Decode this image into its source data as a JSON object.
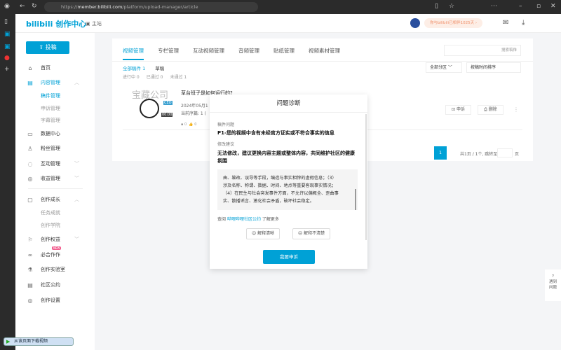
{
  "browser": {
    "url_prefix": "https://",
    "url_host": "member.bilibili.com",
    "url_path": "/platform/upload-manager/article"
  },
  "header": {
    "logo": "bilibili 创作中心",
    "home_link": "主站",
    "promo": "你与bilibili已相伴1025天 ›"
  },
  "sidebar": {
    "upload_label": "投稿",
    "items": [
      {
        "label": "首页",
        "icon": "home-icon"
      },
      {
        "label": "内容管理",
        "icon": "document-icon",
        "active": true
      },
      {
        "label": "稿件管理",
        "sub": true,
        "active": true
      },
      {
        "label": "申诉管理",
        "sub": true
      },
      {
        "label": "字幕管理",
        "sub": true
      },
      {
        "label": "数据中心",
        "icon": "chart-icon"
      },
      {
        "label": "粉丝管理",
        "icon": "user-icon"
      },
      {
        "label": "互动管理",
        "icon": "chat-icon"
      },
      {
        "label": "收益管理",
        "icon": "money-bag-icon"
      },
      {
        "label": "创作成长",
        "icon": "growth-icon"
      },
      {
        "label": "任务成就",
        "sub": true
      },
      {
        "label": "创作学院",
        "sub": true
      },
      {
        "label": "创作权益",
        "icon": "flag-icon"
      },
      {
        "label": "必合作作",
        "icon": "collab-icon",
        "badge": "NEW"
      },
      {
        "label": "创作实验室",
        "icon": "lab-icon"
      },
      {
        "label": "社区公约",
        "icon": "book-icon"
      },
      {
        "label": "创作设置",
        "icon": "settings-icon"
      }
    ]
  },
  "main": {
    "tabs": [
      "视频管理",
      "专栏管理",
      "互动视频管理",
      "音频管理",
      "贴纸管理",
      "视频素材管理"
    ],
    "search_placeholder": "搜索稿件",
    "filters": {
      "all": "全部稿件 1",
      "draft": "草稿",
      "in_progress": "进行中 0",
      "passed": "已通过 0",
      "failed": "未通过 1"
    },
    "zone_select": "全部分区",
    "sort_select": "按稿时间排序",
    "video": {
      "thumb_text": "宝藏公司",
      "thumb_tag": "CEO",
      "duration": "00:00",
      "title": "草台班子是如何运行的?",
      "date": "2024年05月1",
      "seq": "当前序篇: 1 (",
      "comments": "0",
      "likes": "0"
    },
    "actions": {
      "appeal": "申诉",
      "delete": "删除"
    },
    "pagination": {
      "current": "1",
      "info": "共1页 / 1个, 跳转至",
      "unit": "页"
    }
  },
  "modal": {
    "title": "问题诊断",
    "issue_label": "稿件问题",
    "issue": "P1-您的视频中含有未经官方证实或不符合事实的信息",
    "suggest_label": "修改建议",
    "suggest": "无法修改，建议更换内容主题或整体内容，共同维护社区的健康氛围",
    "detail_lines": [
      "由、篡改、误导等手段，编造与事实相悖的虚假信息；（3）",
      "涉及名称、称谓、数据、时间、地点等重要客观事实情况；",
      "（4）在民生与社会突发事件方面，不允许以偏概全、歪曲事",
      "实、散播谣言、激化社会矛盾，破坏社会稳定。"
    ],
    "link_prefix": "查阅",
    "link": "哔哩哔哩社区公约",
    "link_suffix": "了解更多",
    "helpful": "解释清晰",
    "unhelpful": "解释不清楚",
    "appeal_button": "我要申诉"
  },
  "help": {
    "line1": "遇到",
    "line2": "问题"
  },
  "download_bar": "从该页面下载视频"
}
